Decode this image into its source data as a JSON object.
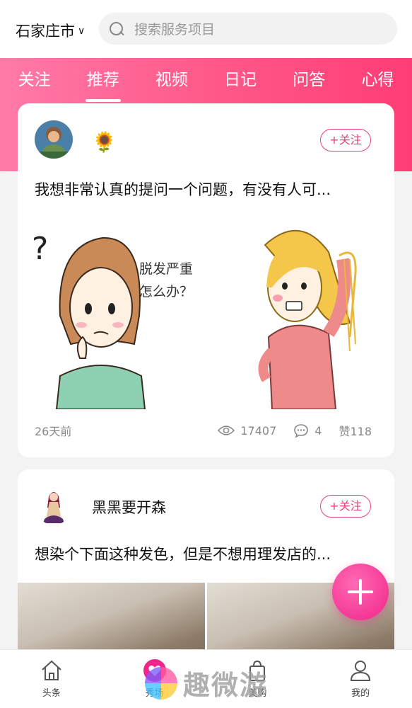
{
  "header": {
    "city": "石家庄市",
    "search_placeholder": "搜索服务项目"
  },
  "tabs": [
    {
      "label": "关注",
      "active": false
    },
    {
      "label": "推荐",
      "active": true
    },
    {
      "label": "视频",
      "active": false
    },
    {
      "label": "日记",
      "active": false
    },
    {
      "label": "问答",
      "active": false
    },
    {
      "label": "心得",
      "active": false
    }
  ],
  "posts": [
    {
      "author": "🌻",
      "follow_label": "+关注",
      "title": "我想非常认真的提问一个问题，有没有人可...",
      "image_caption": "脱发严重\n怎么办？",
      "time": "26天前",
      "views": "17407",
      "comments": "4",
      "likes": "赞118"
    },
    {
      "author": "黑黑要开森",
      "follow_label": "+关注",
      "title": "想染个下面这种发色，但是不想用理发店的..."
    }
  ],
  "bottom_nav": [
    {
      "label": "头条",
      "icon": "home-icon"
    },
    {
      "label": "秀场",
      "icon": "heart-icon"
    },
    {
      "label": "美购",
      "icon": "bag-icon"
    },
    {
      "label": "我的",
      "icon": "user-icon"
    }
  ],
  "watermark": {
    "text": "趣微游"
  },
  "colors": {
    "accent": "#f0248a",
    "banner": "#ff5a8a",
    "follow": "#e8417a"
  }
}
